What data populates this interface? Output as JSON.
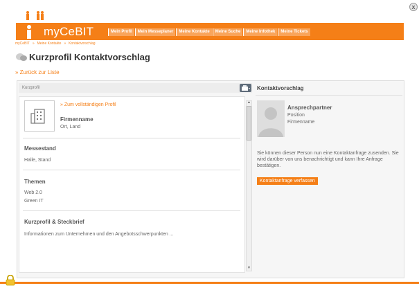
{
  "window": {
    "close_symbol": "x"
  },
  "header": {
    "brand": "myCeBIT",
    "nav_items": [
      "Mein Profil",
      "Mein Messeplaner",
      "Meine Kontakte",
      "Meine Suche",
      "Meine Infothek",
      "Meine Tickets"
    ]
  },
  "breadcrumb": [
    "myCeBIT",
    "»",
    "Meine Kontakte",
    "»",
    "Kontaktvorschlag"
  ],
  "page": {
    "title": "Kurzprofil Kontaktvorschlag",
    "back_link": "» Zurück zur Liste"
  },
  "left_panel": {
    "header": "Kurzprofil",
    "profile_link": "» Zum vollständigen Profil",
    "company_name": "Firmenname",
    "company_location": "Ort, Land",
    "sections": [
      {
        "title": "Messestand",
        "lines": [
          "Halle, Stand"
        ]
      },
      {
        "title": "Themen",
        "lines": [
          "Web 2.0",
          "Green IT"
        ]
      },
      {
        "title": "Kurzprofil & Steckbrief",
        "lines": [
          "Informationen zum Unternehmen und den Angebotsschwerpunkten ..."
        ]
      }
    ]
  },
  "right_panel": {
    "header": "Kontaktvorschlag",
    "contact_name": "Ansprechpartner",
    "contact_position": "Position",
    "contact_company": "Firmenname",
    "info_text": "Sie können dieser Person nun eine Kontaktanfrage zusenden. Sie wird darüber von uns benachrichtigt und kann Ihre Anfrage bestätigen.",
    "cta_label": "Kontaktanfrage verfassen"
  },
  "colors": {
    "accent": "#f57f17",
    "tab": "#f9a45a"
  },
  "icons": [
    "people-figures-icon",
    "brand-person-icon",
    "chat-bubbles-icon",
    "building-icon",
    "print-icon",
    "avatar-silhouette-icon",
    "lock-icon",
    "close-icon",
    "scroll-up-icon",
    "scroll-down-icon"
  ]
}
